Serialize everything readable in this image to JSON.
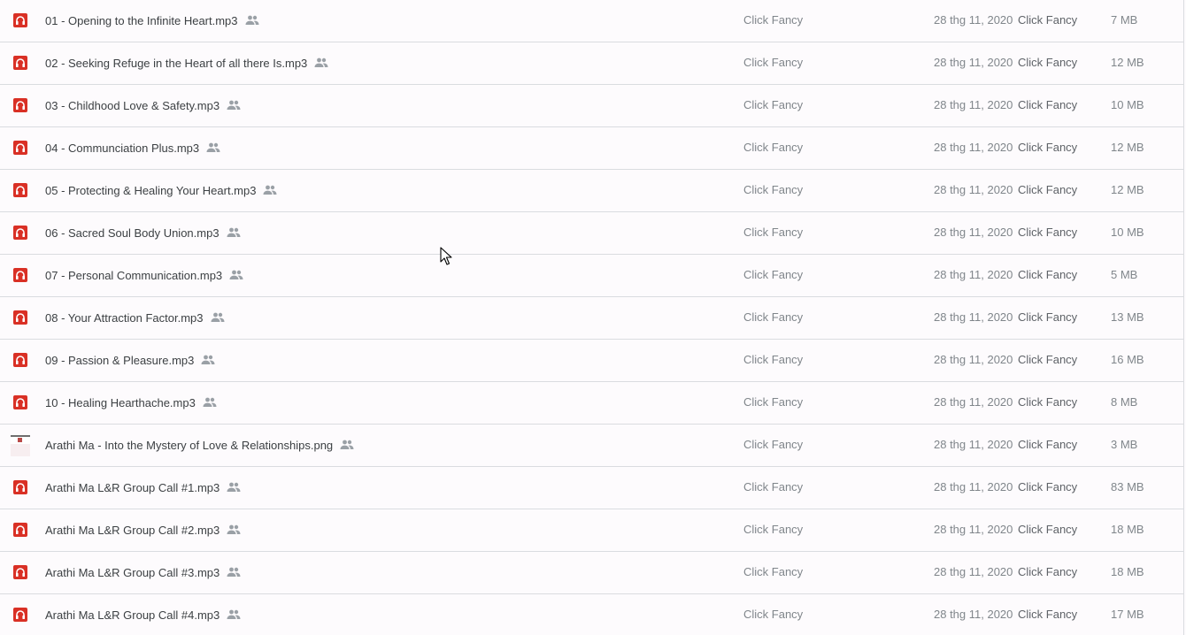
{
  "files": [
    {
      "name": "01 - Opening to the Infinite Heart.mp3",
      "type": "audio",
      "icon": "audio-file-icon",
      "shared": true,
      "owner": "Click Fancy",
      "modified_date": "28 thg 11, 2020",
      "modified_by": "Click Fancy",
      "size": "7 MB"
    },
    {
      "name": "02 - Seeking Refuge in the Heart of all there Is.mp3",
      "type": "audio",
      "icon": "audio-file-icon",
      "shared": true,
      "owner": "Click Fancy",
      "modified_date": "28 thg 11, 2020",
      "modified_by": "Click Fancy",
      "size": "12 MB"
    },
    {
      "name": "03 - Childhood Love & Safety.mp3",
      "type": "audio",
      "icon": "audio-file-icon",
      "shared": true,
      "owner": "Click Fancy",
      "modified_date": "28 thg 11, 2020",
      "modified_by": "Click Fancy",
      "size": "10 MB"
    },
    {
      "name": "04 - Communciation Plus.mp3",
      "type": "audio",
      "icon": "audio-file-icon",
      "shared": true,
      "owner": "Click Fancy",
      "modified_date": "28 thg 11, 2020",
      "modified_by": "Click Fancy",
      "size": "12 MB"
    },
    {
      "name": "05 - Protecting & Healing Your Heart.mp3",
      "type": "audio",
      "icon": "audio-file-icon",
      "shared": true,
      "owner": "Click Fancy",
      "modified_date": "28 thg 11, 2020",
      "modified_by": "Click Fancy",
      "size": "12 MB"
    },
    {
      "name": "06 - Sacred Soul Body Union.mp3",
      "type": "audio",
      "icon": "audio-file-icon",
      "shared": true,
      "owner": "Click Fancy",
      "modified_date": "28 thg 11, 2020",
      "modified_by": "Click Fancy",
      "size": "10 MB"
    },
    {
      "name": "07 - Personal Communication.mp3",
      "type": "audio",
      "icon": "audio-file-icon",
      "shared": true,
      "owner": "Click Fancy",
      "modified_date": "28 thg 11, 2020",
      "modified_by": "Click Fancy",
      "size": "5 MB"
    },
    {
      "name": "08 - Your Attraction Factor.mp3",
      "type": "audio",
      "icon": "audio-file-icon",
      "shared": true,
      "owner": "Click Fancy",
      "modified_date": "28 thg 11, 2020",
      "modified_by": "Click Fancy",
      "size": "13 MB"
    },
    {
      "name": "09 - Passion & Pleasure.mp3",
      "type": "audio",
      "icon": "audio-file-icon",
      "shared": true,
      "owner": "Click Fancy",
      "modified_date": "28 thg 11, 2020",
      "modified_by": "Click Fancy",
      "size": "16 MB"
    },
    {
      "name": "10 - Healing Hearthache.mp3",
      "type": "audio",
      "icon": "audio-file-icon",
      "shared": true,
      "owner": "Click Fancy",
      "modified_date": "28 thg 11, 2020",
      "modified_by": "Click Fancy",
      "size": "8 MB"
    },
    {
      "name": "Arathi Ma - Into the Mystery of Love & Relationships.png",
      "type": "image",
      "icon": "image-thumbnail-icon",
      "shared": true,
      "owner": "Click Fancy",
      "modified_date": "28 thg 11, 2020",
      "modified_by": "Click Fancy",
      "size": "3 MB"
    },
    {
      "name": "Arathi Ma L&R Group Call #1.mp3",
      "type": "audio",
      "icon": "audio-file-icon",
      "shared": true,
      "owner": "Click Fancy",
      "modified_date": "28 thg 11, 2020",
      "modified_by": "Click Fancy",
      "size": "83 MB"
    },
    {
      "name": "Arathi Ma L&R Group Call #2.mp3",
      "type": "audio",
      "icon": "audio-file-icon",
      "shared": true,
      "owner": "Click Fancy",
      "modified_date": "28 thg 11, 2020",
      "modified_by": "Click Fancy",
      "size": "18 MB"
    },
    {
      "name": "Arathi Ma L&R Group Call #3.mp3",
      "type": "audio",
      "icon": "audio-file-icon",
      "shared": true,
      "owner": "Click Fancy",
      "modified_date": "28 thg 11, 2020",
      "modified_by": "Click Fancy",
      "size": "18 MB"
    },
    {
      "name": "Arathi Ma L&R Group Call #4.mp3",
      "type": "audio",
      "icon": "audio-file-icon",
      "shared": true,
      "owner": "Click Fancy",
      "modified_date": "28 thg 11, 2020",
      "modified_by": "Click Fancy",
      "size": "17 MB"
    }
  ],
  "colors": {
    "audio_icon": "#d93025",
    "row_divider": "#dadce0",
    "background": "#fdfbfd",
    "name_text": "#3c4043",
    "meta_text": "#80868b"
  },
  "icons": {
    "shared": "people-shared-icon",
    "cursor": "mouse-pointer-icon"
  }
}
